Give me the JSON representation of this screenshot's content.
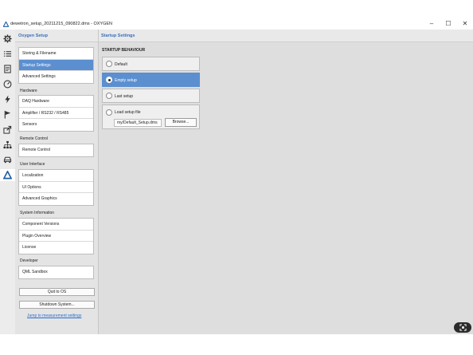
{
  "window": {
    "title": "dewetron_setup_20211215_090822.dms - OXYGEN",
    "minimize": "–",
    "maximize": "☐",
    "close": "✕"
  },
  "iconbar": [
    {
      "icon": "gear-icon",
      "active": false
    },
    {
      "icon": "list-icon",
      "active": false
    },
    {
      "icon": "document-icon",
      "active": false
    },
    {
      "icon": "gauge-icon",
      "active": false
    },
    {
      "icon": "lightning-icon",
      "active": false
    },
    {
      "icon": "flag-icon",
      "active": false
    },
    {
      "icon": "export-icon",
      "active": false
    },
    {
      "icon": "network-icon",
      "active": false
    },
    {
      "icon": "car-icon",
      "active": false
    },
    {
      "icon": "oxygen-logo-icon",
      "active": true
    }
  ],
  "sidebar": {
    "header": "Oxygen Setup",
    "groups": [
      {
        "title": "",
        "items": [
          "Storing & Filename",
          "Startup Settings",
          "Advanced Settings"
        ]
      },
      {
        "title": "Hardware",
        "items": [
          "DAQ Hardware",
          "Amplifier / RS232 / RS485",
          "Sensors"
        ]
      },
      {
        "title": "Remote Control",
        "items": [
          "Remote Control"
        ]
      },
      {
        "title": "User Interface",
        "items": [
          "Localization",
          "UI Options",
          "Advanced Graphics"
        ]
      },
      {
        "title": "System Information",
        "items": [
          "Component Versions",
          "Plugin Overview",
          "License"
        ]
      },
      {
        "title": "Developer",
        "items": [
          "QML Sandbox"
        ]
      }
    ],
    "selected": "Startup Settings",
    "quit_label": "Quit to OS",
    "shutdown_label": "Shutdown System...",
    "jump_link": "Jump to measurement settings"
  },
  "main": {
    "header": "Startup Settings",
    "section": "STARTUP BEHAVIOUR",
    "options": [
      "Default",
      "Empty setup",
      "Last setup",
      "Load setup file"
    ],
    "selected_option": "Empty setup",
    "file_value": "my/Default_Setup.dms",
    "browse_label": "Browse..."
  },
  "colors": {
    "accent": "#5b8fd0",
    "header_text": "#3b6fb8",
    "link": "#2d6ec7"
  }
}
